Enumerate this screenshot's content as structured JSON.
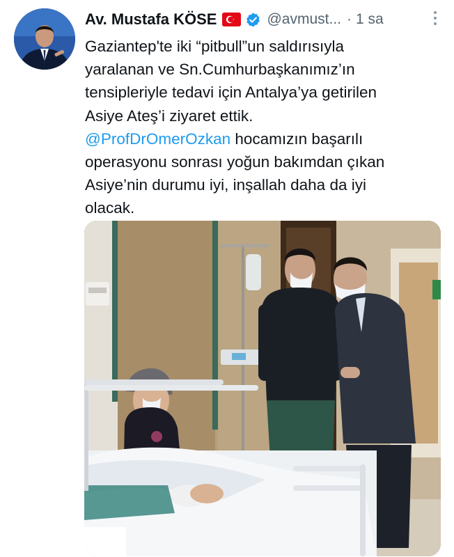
{
  "author": {
    "name": "Av. Mustafa KÖSE",
    "handle": "@avmust...",
    "separator": "·",
    "time": "1 sa",
    "flag_icon": "turkey-flag-icon",
    "verified_icon": "verified-badge-icon",
    "more_icon": "more-options-icon"
  },
  "tweet": {
    "line1": "Gaziantep'te iki “pitbull”un saldırısıyla",
    "line2": "yaralanan ve Sn.Cumhurbaşkanımız’ın",
    "line3": "tensipleriyle tedavi için Antalya’ya getirilen",
    "line4": "Asiye Ateş’i  ziyaret ettik.",
    "mention": "@ProfDrOmerOzkan",
    "line5_rest": " hocamızın başarılı",
    "line6": "operasyonu sonrası yoğun bakımdan çıkan",
    "line7": "Asiye’nin durumu iyi, inşallah daha da iyi",
    "line8": "olacak."
  },
  "colors": {
    "text": "#0f1419",
    "secondary": "#536471",
    "link": "#1d9bf0",
    "verified": "#1d9bf0",
    "flag_red": "#e30a17"
  }
}
